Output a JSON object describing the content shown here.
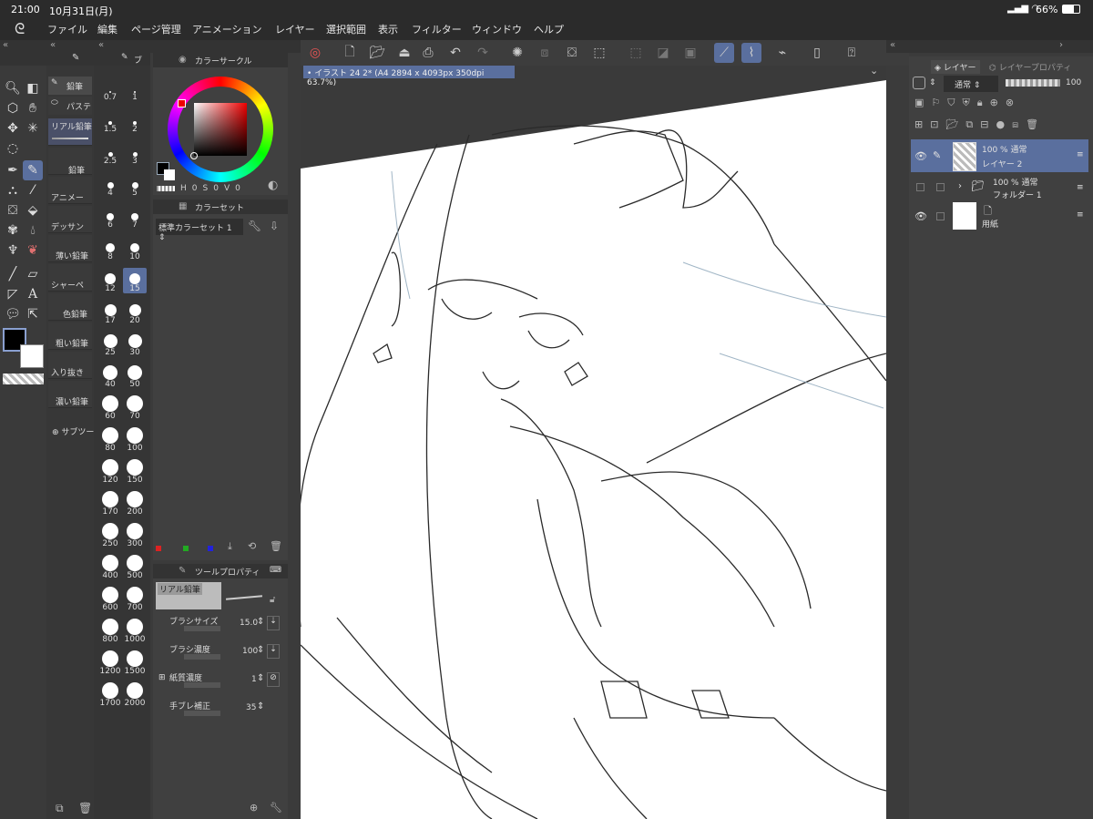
{
  "status": {
    "time": "21:00",
    "date": "10月31日(月)",
    "battery": "66%"
  },
  "menu": [
    "ファイル",
    "編集",
    "ページ管理",
    "アニメーション",
    "レイヤー",
    "選択範囲",
    "表示",
    "フィルター",
    "ウィンドウ",
    "ヘルプ"
  ],
  "subtool_tab": "鉛筆",
  "subtool_tab2": "パステ",
  "subtools": [
    "リアル鉛筆",
    "鉛筆",
    "アニメー",
    "デッサン",
    "薄い鉛筆",
    "シャーペ",
    "色鉛筆",
    "粗い鉛筆",
    "入り抜き",
    "濃い鉛筆"
  ],
  "subtool_add": "サブツー",
  "brush_sizes": [
    "0.7",
    "1",
    "1.5",
    "2",
    "2.5",
    "3",
    "4",
    "5",
    "6",
    "7",
    "8",
    "10",
    "12",
    "15",
    "17",
    "20",
    "25",
    "30",
    "40",
    "50",
    "60",
    "70",
    "80",
    "100",
    "120",
    "150",
    "170",
    "200",
    "250",
    "300",
    "400",
    "500",
    "600",
    "700",
    "800",
    "1000",
    "1200",
    "1500",
    "1700",
    "2000"
  ],
  "brush_panel_title": "ブ",
  "color_circle": {
    "title": "カラーサークル",
    "h": "H",
    "h_val": "0",
    "s": "S",
    "s_val": "0",
    "v": "V",
    "v_val": "0"
  },
  "color_set": {
    "title": "カラーセット",
    "selector": "標準カラーセット 1"
  },
  "tool_property": {
    "title": "ツールプロパティ",
    "preset": "リアル鉛筆",
    "brush_size_label": "ブラシサイズ",
    "brush_size": "15.0",
    "brush_density_label": "ブラシ濃度",
    "brush_density": "100",
    "paper_label": "紙質濃度",
    "paper": "1",
    "stabilization_label": "手ブレ補正",
    "stabilization": "35"
  },
  "canvas_tab": "イラスト 24 2* (A4 2894 x 4093px 350dpi 63.7%)",
  "layer_panel": {
    "tab1": "レイヤー",
    "tab2": "レイヤープロパティ",
    "blend": "通常",
    "opacity": "100"
  },
  "layers": [
    {
      "line1": "100 % 通常",
      "line2": "レイヤー 2"
    },
    {
      "line1": "100 % 通常",
      "line2": "フォルダー 1"
    },
    {
      "line1": "",
      "line2": "用紙"
    }
  ],
  "colors": {
    "accent": "#5a6f9e",
    "panel": "#404040",
    "menubar": "#2b2b2b"
  }
}
